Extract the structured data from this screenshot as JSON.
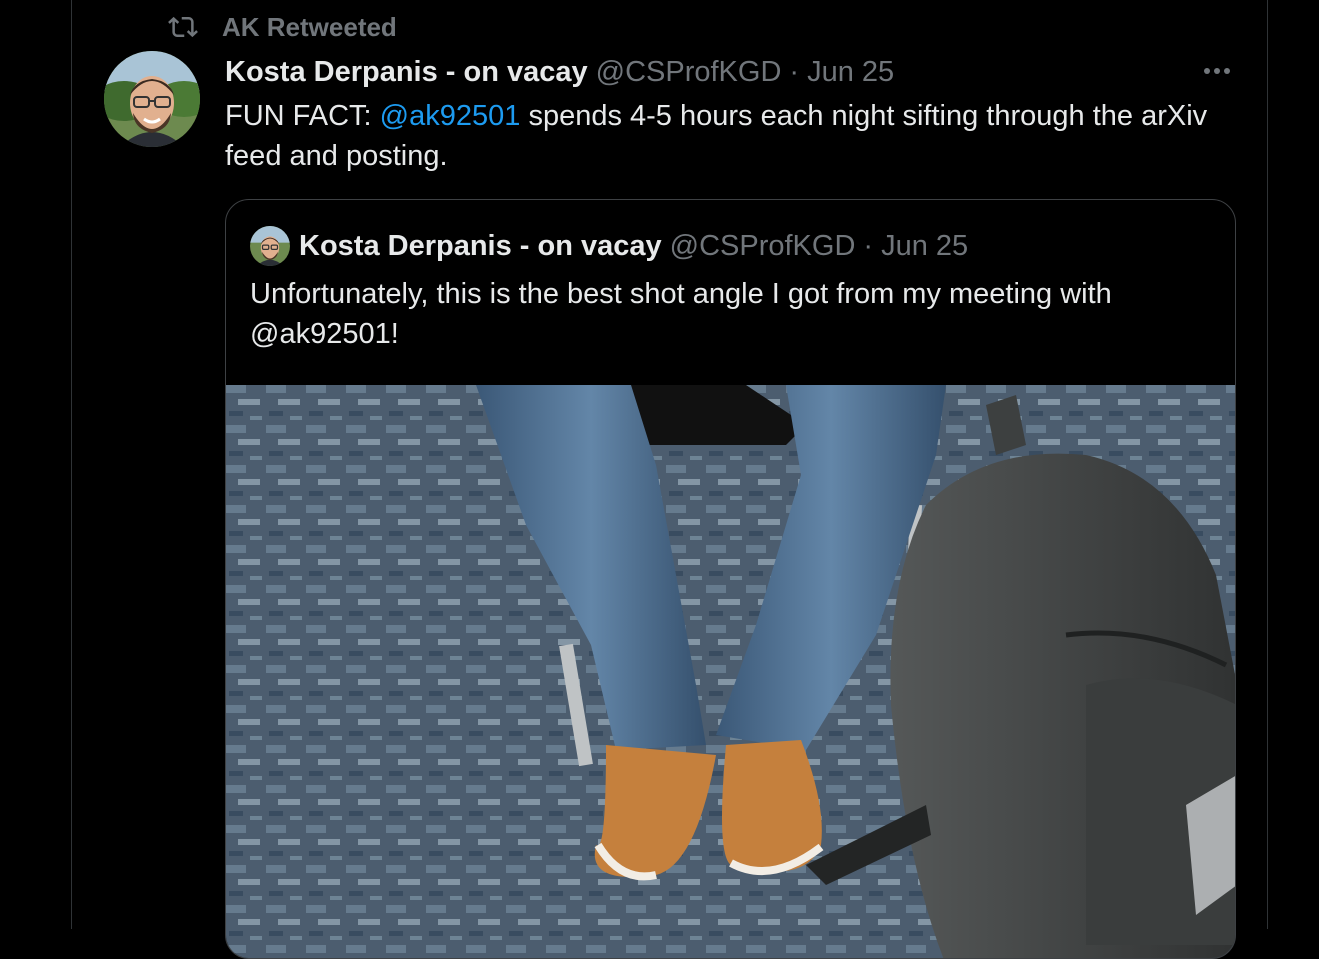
{
  "retweet": {
    "label": "AK Retweeted",
    "icon": "retweet-icon"
  },
  "tweet": {
    "display_name": "Kosta Derpanis - on vacay",
    "handle": "@CSProfKGD",
    "separator": "·",
    "date": "Jun 25",
    "text_before": "FUN FACT: ",
    "mention": "@ak92501",
    "text_after": " spends 4-5 hours each night sifting through the arXiv feed and posting.",
    "more_icon": "more-icon"
  },
  "quote": {
    "display_name": "Kosta Derpanis - on vacay",
    "handle": "@CSProfKGD",
    "separator": "·",
    "date": "Jun 25",
    "text": "Unfortunately, this is the best shot angle I got from my meeting with @ak92501!"
  },
  "colors": {
    "background": "#000000",
    "text": "#e7e9ea",
    "muted": "#71767b",
    "link": "#1d9bf0",
    "border": "#2f3336"
  }
}
